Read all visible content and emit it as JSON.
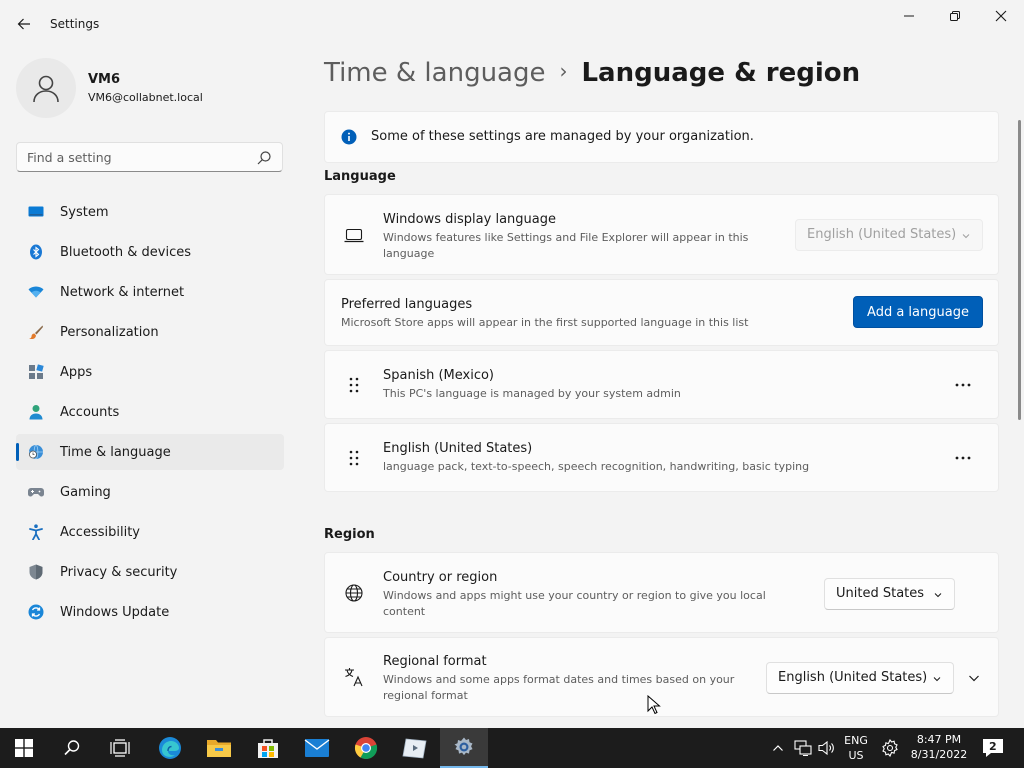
{
  "window": {
    "title": "Settings"
  },
  "profile": {
    "name": "VM6",
    "email": "VM6@collabnet.local"
  },
  "search": {
    "placeholder": "Find a setting"
  },
  "sidebar": {
    "items": [
      {
        "label": "System",
        "icon": "system-icon"
      },
      {
        "label": "Bluetooth & devices",
        "icon": "bluetooth-icon"
      },
      {
        "label": "Network & internet",
        "icon": "wifi-icon"
      },
      {
        "label": "Personalization",
        "icon": "brush-icon"
      },
      {
        "label": "Apps",
        "icon": "apps-icon"
      },
      {
        "label": "Accounts",
        "icon": "person-icon"
      },
      {
        "label": "Time & language",
        "icon": "globe-clock-icon",
        "active": true
      },
      {
        "label": "Gaming",
        "icon": "gamepad-icon"
      },
      {
        "label": "Accessibility",
        "icon": "accessibility-icon"
      },
      {
        "label": "Privacy & security",
        "icon": "shield-icon"
      },
      {
        "label": "Windows Update",
        "icon": "update-icon"
      }
    ]
  },
  "breadcrumb": {
    "parent": "Time & language",
    "separator": "›",
    "current": "Language & region"
  },
  "notice": {
    "text": "Some of these settings are managed by your organization."
  },
  "language": {
    "section_title": "Language",
    "display": {
      "title": "Windows display language",
      "description": "Windows features like Settings and File Explorer will appear in this language",
      "value": "English (United States)"
    },
    "preferred": {
      "title": "Preferred languages",
      "description": "Microsoft Store apps will appear in the first supported language in this list",
      "button": "Add a language"
    },
    "list": [
      {
        "name": "Spanish (Mexico)",
        "description": "This PC's language is managed by your system admin"
      },
      {
        "name": "English (United States)",
        "description": "language pack, text-to-speech, speech recognition, handwriting, basic typing"
      }
    ]
  },
  "region": {
    "section_title": "Region",
    "country": {
      "title": "Country or region",
      "description": "Windows and apps might use your country or region to give you local content",
      "value": "United States"
    },
    "format": {
      "title": "Regional format",
      "description": "Windows and some apps format dates and times based on your regional format",
      "value": "English (United States)"
    }
  },
  "taskbar": {
    "lang_top": "ENG",
    "lang_bottom": "US",
    "time": "8:47 PM",
    "date": "8/31/2022",
    "notifications": "2"
  },
  "colors": {
    "accent": "#005fb8",
    "background": "#f3f3f3",
    "card": "#fbfbfb",
    "taskbar": "#1c1c1c"
  }
}
